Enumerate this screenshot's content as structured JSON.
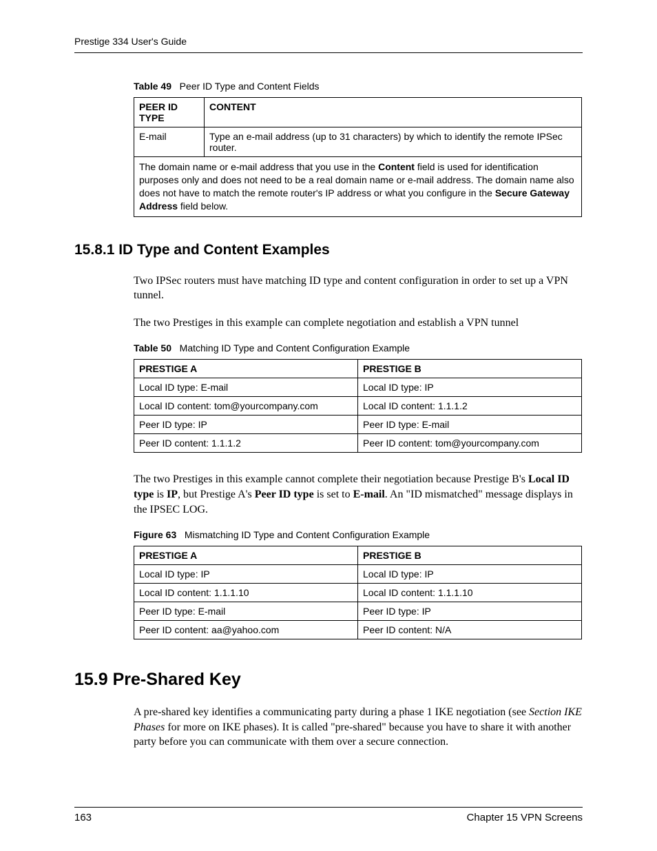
{
  "header": {
    "title": "Prestige 334 User's Guide"
  },
  "table49": {
    "caption_label": "Table 49",
    "caption_text": "Peer ID Type and Content Fields",
    "header_col1": "PEER ID TYPE",
    "header_col2": "CONTENT",
    "row1_col1": "E-mail",
    "row1_col2": "Type an e-mail address (up to 31 characters) by which to identify the remote IPSec router.",
    "footnote_pre": "The domain name or e-mail address that you use in the ",
    "footnote_content_bold": "Content",
    "footnote_mid": " field is used for identification purposes only and does not need to be a real domain name or e-mail address. The domain name also does not have to match the remote router's IP address or what you configure in the ",
    "footnote_gateway_bold": "Secure Gateway Address",
    "footnote_post": " field below."
  },
  "subsection": {
    "heading": "15.8.1  ID Type and Content Examples",
    "para1": "Two IPSec routers must have matching ID type and content configuration in order to set up a VPN tunnel.",
    "para2": "The two Prestiges in this example can complete negotiation and establish a VPN tunnel"
  },
  "table50": {
    "caption_label": "Table 50",
    "caption_text": "Matching ID Type and Content Configuration Example",
    "header_a": "PRESTIGE A",
    "header_b": "PRESTIGE B",
    "r1a": "Local ID type: E-mail",
    "r1b": "Local ID type: IP",
    "r2a": "Local ID content: tom@yourcompany.com",
    "r2b": "Local ID content: 1.1.1.2",
    "r3a": "Peer ID type: IP",
    "r3b": "Peer ID type: E-mail",
    "r4a": "Peer ID content: 1.1.1.2",
    "r4b": "Peer ID content: tom@yourcompany.com"
  },
  "mismatch_para": {
    "pre": "The two Prestiges in this example cannot complete their negotiation because Prestige B's ",
    "b1": "Local ID type",
    "mid1": " is ",
    "b2": "IP",
    "mid2": ", but Prestige A's ",
    "b3": "Peer ID type",
    "mid3": " is set to ",
    "b4": "E-mail",
    "post": ". An \"ID mismatched\" message displays in the IPSEC LOG."
  },
  "figure63": {
    "caption_label": "Figure 63",
    "caption_text": "Mismatching ID Type and Content Configuration Example",
    "header_a": "PRESTIGE A",
    "header_b": "PRESTIGE B",
    "r1a": "Local ID type: IP",
    "r1b": "Local ID type: IP",
    "r2a": "Local ID content: 1.1.1.10",
    "r2b": "Local ID content: 1.1.1.10",
    "r3a": "Peer ID type: E-mail",
    "r3b": "Peer ID type: IP",
    "r4a": "Peer ID content: aa@yahoo.com",
    "r4b": "Peer ID content: N/A"
  },
  "section159": {
    "heading": "15.9  Pre-Shared Key",
    "para_pre": "A pre-shared key identifies a communicating party during a phase 1 IKE negotiation (see ",
    "para_italic": "Section IKE Phases",
    "para_post": " for more on IKE phases). It is called \"pre-shared\" because you have to share it with another party before you can communicate with them over a secure connection."
  },
  "footer": {
    "page_number": "163",
    "chapter": "Chapter 15 VPN Screens"
  }
}
